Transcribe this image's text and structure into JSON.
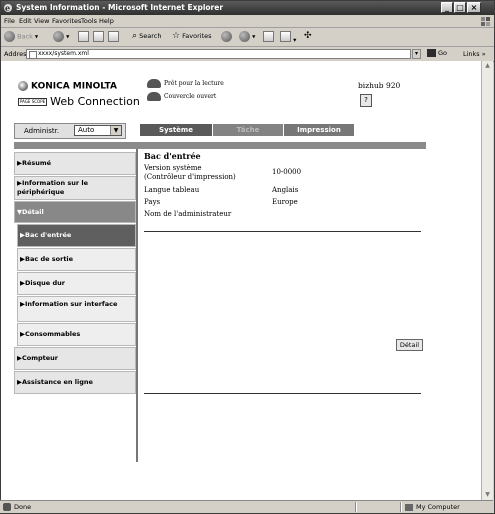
{
  "window": {
    "title": "System Information - Microsoft Internet Explorer"
  },
  "menu": [
    "File",
    "Edit",
    "View",
    "Favorites",
    "Tools",
    "Help"
  ],
  "toolbar": {
    "back": "Back",
    "search": "Search",
    "favorites": "Favorites"
  },
  "address": {
    "label": "Address",
    "url": "xxxx/system.xml",
    "go": "Go",
    "links": "Links"
  },
  "status": {
    "left": "Done",
    "right": "My Computer"
  },
  "header": {
    "brand": "KONICA MINOLTA",
    "pagescope": "PAGE SCOPE",
    "product": "Web Connection",
    "status_ready": "Prêt pour la lecture",
    "status_cover": "Couvercle ouvert",
    "model": "bizhub 920",
    "help_icon_label": "?"
  },
  "mode": {
    "label": "Administr.",
    "selected": "Auto"
  },
  "tabs": [
    {
      "label": "Système",
      "state": "active"
    },
    {
      "label": "Tâche",
      "state": "inactive"
    },
    {
      "label": "Impression",
      "state": "normal"
    }
  ],
  "sidebar": [
    {
      "label": "▶Résumé"
    },
    {
      "label": "▶Information sur le périphérique"
    },
    {
      "label": "▼Détail"
    },
    {
      "label": "▶Bac d'entrée"
    },
    {
      "label": "▶Bac de sortie"
    },
    {
      "label": "▶Disque dur"
    },
    {
      "label": "▶Information sur interface"
    },
    {
      "label": "▶Consommables"
    },
    {
      "label": "▶Compteur"
    },
    {
      "label": "▶Assistance en ligne"
    }
  ],
  "content": {
    "title": "Bac d'entrée",
    "rows": [
      {
        "label": "Version système",
        "label2": "(Contrôleur d'impression)",
        "value": "10-0000"
      },
      {
        "label": "Langue tableau",
        "value": "Anglais"
      },
      {
        "label": "Pays",
        "value": "Europe"
      },
      {
        "label": "Nom de l'administrateur",
        "value": ""
      }
    ],
    "detail_button": "Détail"
  },
  "colors": {
    "titlebar": "#3a3a3a",
    "tab": "#777777",
    "selected_nav": "#5f5f5f",
    "chrome": "#d4d0c8"
  }
}
